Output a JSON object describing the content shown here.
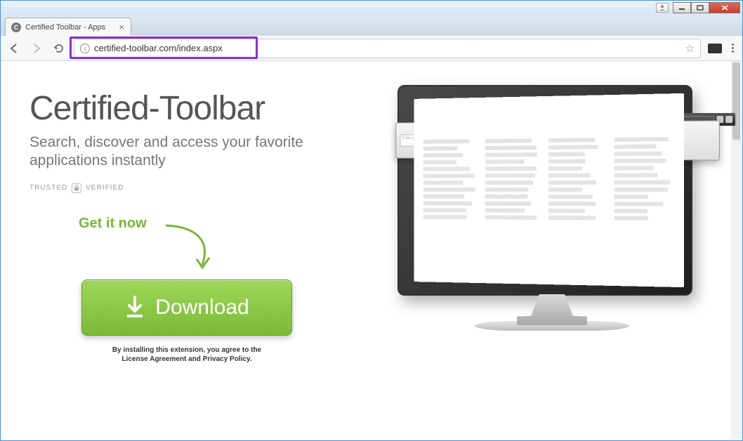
{
  "window": {
    "tab_title": "Certified Toolbar - Apps"
  },
  "address_bar": {
    "url": "certified-toolbar.com/index.aspx"
  },
  "page": {
    "title": "Certified-Toolbar",
    "subtitle": "Search, discover and access your favorite applications instantly",
    "trusted_label": "TRUSTED",
    "verified_label": "VERIFIED",
    "cta_label": "Get it now",
    "download_label": "Download",
    "disclaimer_line1": "By installing this extension, you agree to the",
    "disclaimer_line2": "License Agreement and Privacy Policy."
  },
  "illustration": {
    "search_placeholder": "Enter your search here",
    "toolbar_colors": [
      "#2e7dd1",
      "#2e7dd1",
      "#e8a23a",
      "#3aa54a",
      "#e4852b",
      "#4a66c9",
      "#d6b83a",
      "#c04040"
    ]
  }
}
